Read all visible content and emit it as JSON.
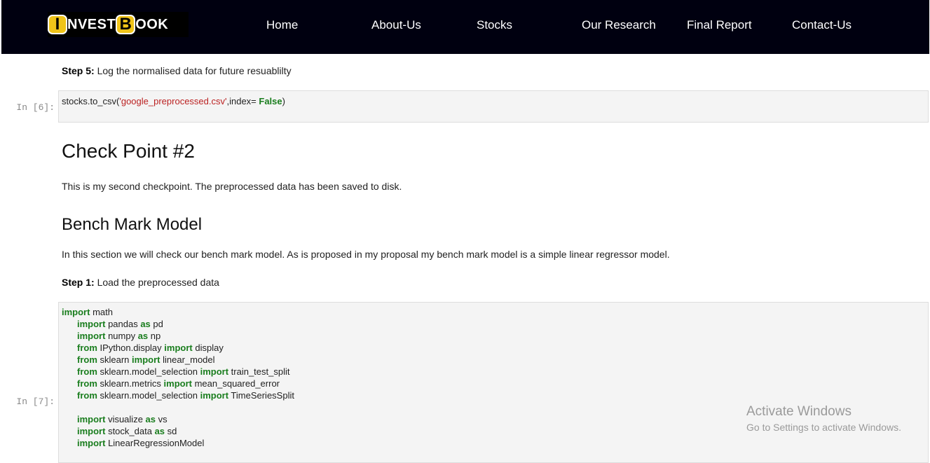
{
  "navbar": {
    "logo": {
      "first_letter": "I",
      "part1": "NVEST",
      "second_letter": "B",
      "part2": "OOK"
    },
    "items": [
      "Home",
      "About-Us",
      "Stocks",
      "Our Research",
      "Final Report",
      "Contact-Us"
    ]
  },
  "notebook": {
    "step5": {
      "label": "Step 5:",
      "text": " Log the normalised data for future resuablilty"
    },
    "cell6": {
      "prompt": "In [6]:",
      "line": {
        "a": "stocks.to_csv(",
        "str": "'google_preprocessed.csv'",
        "b": ",index= ",
        "kw": "False",
        "c": ")"
      }
    },
    "checkpoint_title": "Check Point #2",
    "checkpoint_text": "This is my second checkpoint. The preprocessed data has been saved to disk.",
    "benchmark_title": "Bench Mark Model",
    "benchmark_text": "In this section we will check our bench mark model. As is proposed in my proposal my bench mark model is a simple linear regressor model.",
    "step1": {
      "label": "Step 1:",
      "text": " Load the preprocessed data"
    },
    "cell7": {
      "prompt": "In [7]:",
      "lines": [
        {
          "k1": "import",
          "t1": " math"
        },
        {
          "k1": "import",
          "t1": " pandas ",
          "k2": "as",
          "t2": " pd"
        },
        {
          "k1": "import",
          "t1": " numpy ",
          "k2": "as",
          "t2": " np"
        },
        {
          "k1": "from",
          "t1": " IPython.display ",
          "k2": "import",
          "t2": " display"
        },
        {
          "k1": "from",
          "t1": " sklearn ",
          "k2": "import",
          "t2": " linear_model"
        },
        {
          "k1": "from",
          "t1": " sklearn.model_selection ",
          "k2": "import",
          "t2": " train_test_split"
        },
        {
          "k1": "from",
          "t1": " sklearn.metrics ",
          "k2": "import",
          "t2": " mean_squared_error"
        },
        {
          "k1": "from",
          "t1": " sklearn.model_selection ",
          "k2": "import",
          "t2": " TimeSeriesSplit"
        },
        {
          "k1": "import",
          "t1": " visualize ",
          "k2": "as",
          "t2": " vs"
        },
        {
          "k1": "import",
          "t1": " stock_data ",
          "k2": "as",
          "t2": " sd"
        },
        {
          "k1": "import",
          "t1": " LinearRegressionModel"
        }
      ]
    }
  },
  "watermark": {
    "title": "Activate Windows",
    "subtitle": "Go to Settings to activate Windows."
  },
  "colors": {
    "navbar_bg": "#000010",
    "logo_badge": "#f0c419",
    "keyword": "#197d1d",
    "string": "#b22222",
    "code_bg": "#f4f4f4"
  }
}
